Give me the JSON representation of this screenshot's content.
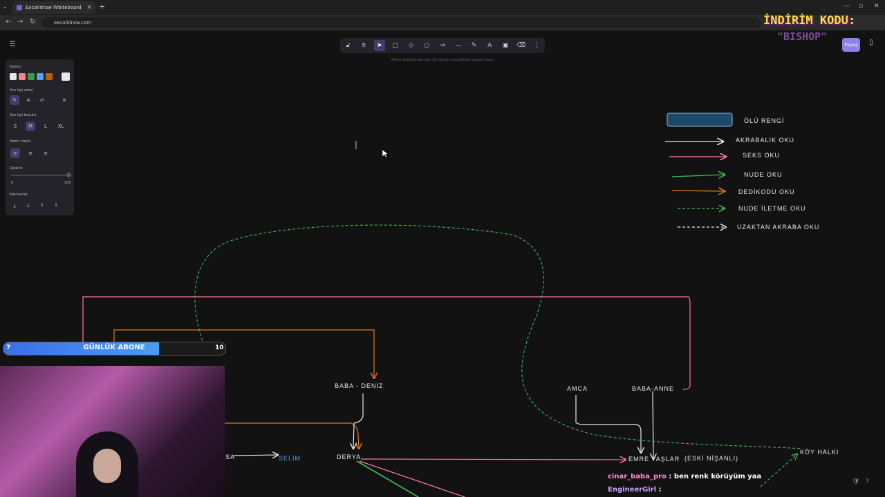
{
  "browser": {
    "tab_title": "Excalidraw Whiteboard",
    "url": "excalidraw.com",
    "tab_close": "×",
    "new_tab": "+"
  },
  "toolbar": {
    "tools": [
      "lock",
      "hand",
      "selection",
      "rectangle",
      "diamond",
      "ellipse",
      "arrow",
      "line",
      "draw",
      "text",
      "image",
      "eraser",
      "more"
    ],
    "active": "selection",
    "hint": "Metni düzenlemek için çift tıklayın veya Enter tuşuna basın"
  },
  "panel": {
    "stroke_label": "Kontur",
    "stroke_colors": [
      "#e8e8e8",
      "#ff8383",
      "#3a994c",
      "#56a2e8",
      "#b76100"
    ],
    "current_color": "#e8e8e8",
    "font_family_label": "Yazı tipi ailesi",
    "font_size_label": "Yazı tipi boyutu",
    "font_sizes": [
      "S",
      "M",
      "L",
      "XL"
    ],
    "selected_size": "M",
    "text_align_label": "Metin hizala",
    "opacity_label": "Opaklık",
    "opacity_min": "0",
    "opacity_max": "100",
    "layers_label": "Katmanlar"
  },
  "header_right": {
    "share_label": "Paylaş",
    "promo_line1": "İNDİRİM KODU:",
    "promo_line2": "\"BISHOP\""
  },
  "legend": [
    {
      "label": "ÖLÜ RENGİ",
      "kind": "box",
      "color": "#1d4a6a"
    },
    {
      "label": "AKRABALIK OKU",
      "kind": "arrow",
      "color": "#e8e8e8"
    },
    {
      "label": "SEKS OKU",
      "kind": "arrow",
      "color": "#ff7a9c"
    },
    {
      "label": "NUDE OKU",
      "kind": "arrow",
      "color": "#40c057"
    },
    {
      "label": "DEDİKODU OKU",
      "kind": "arrow",
      "color": "#e07a1f"
    },
    {
      "label": "NUDE İLETME OKU",
      "kind": "dashed",
      "color": "#40c057"
    },
    {
      "label": "UZAKTAN AKRABA OKU",
      "kind": "dashed",
      "color": "#e8e8e8"
    }
  ],
  "nodes": {
    "baba_deniz": "BABA - DENİZ",
    "derya": "DERYA",
    "amca": "AMCA",
    "baba_anne": "BABA-ANNE",
    "emre": "EMRE YAŞLAR",
    "eski_nisanli": "(ESKİ NİŞANLI)",
    "koy_halki": "KÖY HALKI",
    "selim": "SELİM",
    "sa": "SA"
  },
  "subscriber_goal": {
    "title": "GÜNLÜK ABONE",
    "current": "7",
    "target": "10",
    "progress": 0.7
  },
  "chat": [
    {
      "name": "cinar_baba_pro",
      "message": "ben renk körüyüm yaa"
    },
    {
      "name": "EngineerGirl",
      "message": ""
    }
  ]
}
